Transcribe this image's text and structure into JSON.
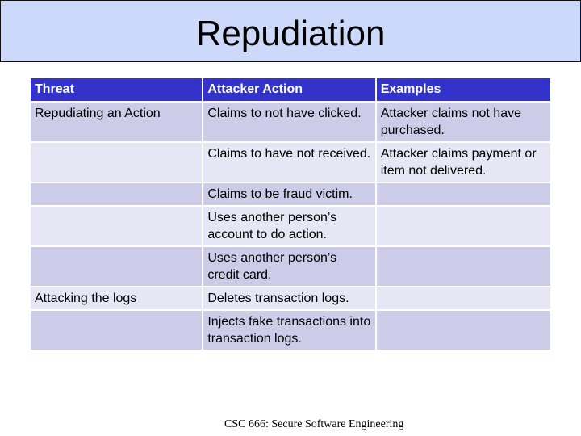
{
  "slide": {
    "title": "Repudiation",
    "footer": "CSC 666: Secure Software Engineering"
  },
  "table": {
    "headers": [
      "Threat",
      "Attacker Action",
      "Examples"
    ],
    "rows": [
      [
        "Repudiating an Action",
        "Claims to not have clicked.",
        "Attacker claims not have purchased."
      ],
      [
        "",
        "Claims to have not received.",
        "Attacker claims payment or item not delivered."
      ],
      [
        "",
        "Claims to be fraud victim.",
        ""
      ],
      [
        "",
        "Uses another person’s account to do action.",
        ""
      ],
      [
        "",
        "Uses another person’s credit card.",
        ""
      ],
      [
        "Attacking the logs",
        "Deletes transaction logs.",
        ""
      ],
      [
        "",
        "Injects fake transactions into transaction logs.",
        ""
      ]
    ]
  },
  "colors": {
    "title_bg": "#ccd9fb",
    "header_bg": "#3333cc",
    "row_odd": "#cccce8",
    "row_even": "#e6e6f4"
  }
}
